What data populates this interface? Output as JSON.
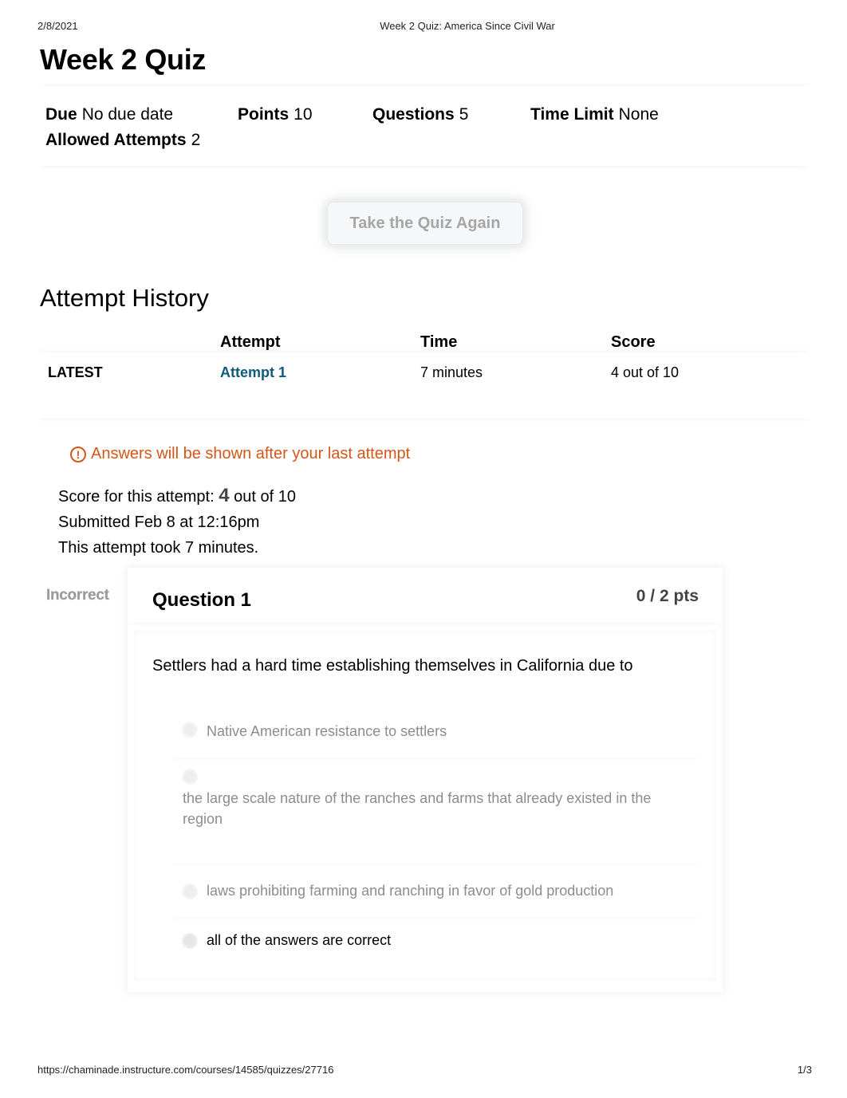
{
  "print_header": {
    "date": "2/8/2021",
    "document_title": "Week 2 Quiz: America Since Civil War"
  },
  "page_title": "Week 2 Quiz",
  "quiz_details": {
    "due": {
      "label": "Due",
      "value": "No due date"
    },
    "points": {
      "label": "Points",
      "value": "10"
    },
    "questions": {
      "label": "Questions",
      "value": "5"
    },
    "time_limit": {
      "label": "Time Limit",
      "value": "None"
    },
    "allowed_attempts": {
      "label": "Allowed Attempts",
      "value": "2"
    }
  },
  "retake_button": "Take the Quiz Again",
  "attempt_history": {
    "title": "Attempt History",
    "columns": [
      "",
      "Attempt",
      "Time",
      "Score"
    ],
    "rows": [
      {
        "tag": "LATEST",
        "attempt": "Attempt 1",
        "time": "7 minutes",
        "score": "4 out of 10"
      }
    ]
  },
  "notice": {
    "icon": "warning-circle-icon",
    "text": "Answers will be shown after your last attempt",
    "color": "#d4561a"
  },
  "summary": {
    "score_prefix": "Score for this attempt:",
    "score_value": "4",
    "score_suffix": "out of 10",
    "submitted": "Submitted Feb 8 at 12:16pm",
    "duration": "This attempt took 7 minutes."
  },
  "questions": [
    {
      "status": "Incorrect",
      "title": "Question 1",
      "points": "0 / 2 pts",
      "text": "Settlers had a hard time establishing themselves in California due to",
      "answers": [
        {
          "text": "Native American resistance to settlers",
          "selected": false
        },
        {
          "text": "the large scale nature of the ranches and farms that already existed in the region",
          "selected": false
        },
        {
          "text": "laws prohibiting farming and ranching in favor of gold production",
          "selected": false
        },
        {
          "text": "all of the answers are correct",
          "selected": true
        }
      ]
    }
  ],
  "print_footer": {
    "url": "https://chaminade.instructure.com/courses/14585/quizzes/27716",
    "page": "1/3"
  },
  "colors": {
    "link": "#0e5a7a",
    "warning": "#d4561a",
    "muted_answer": "#8c8c8c"
  }
}
